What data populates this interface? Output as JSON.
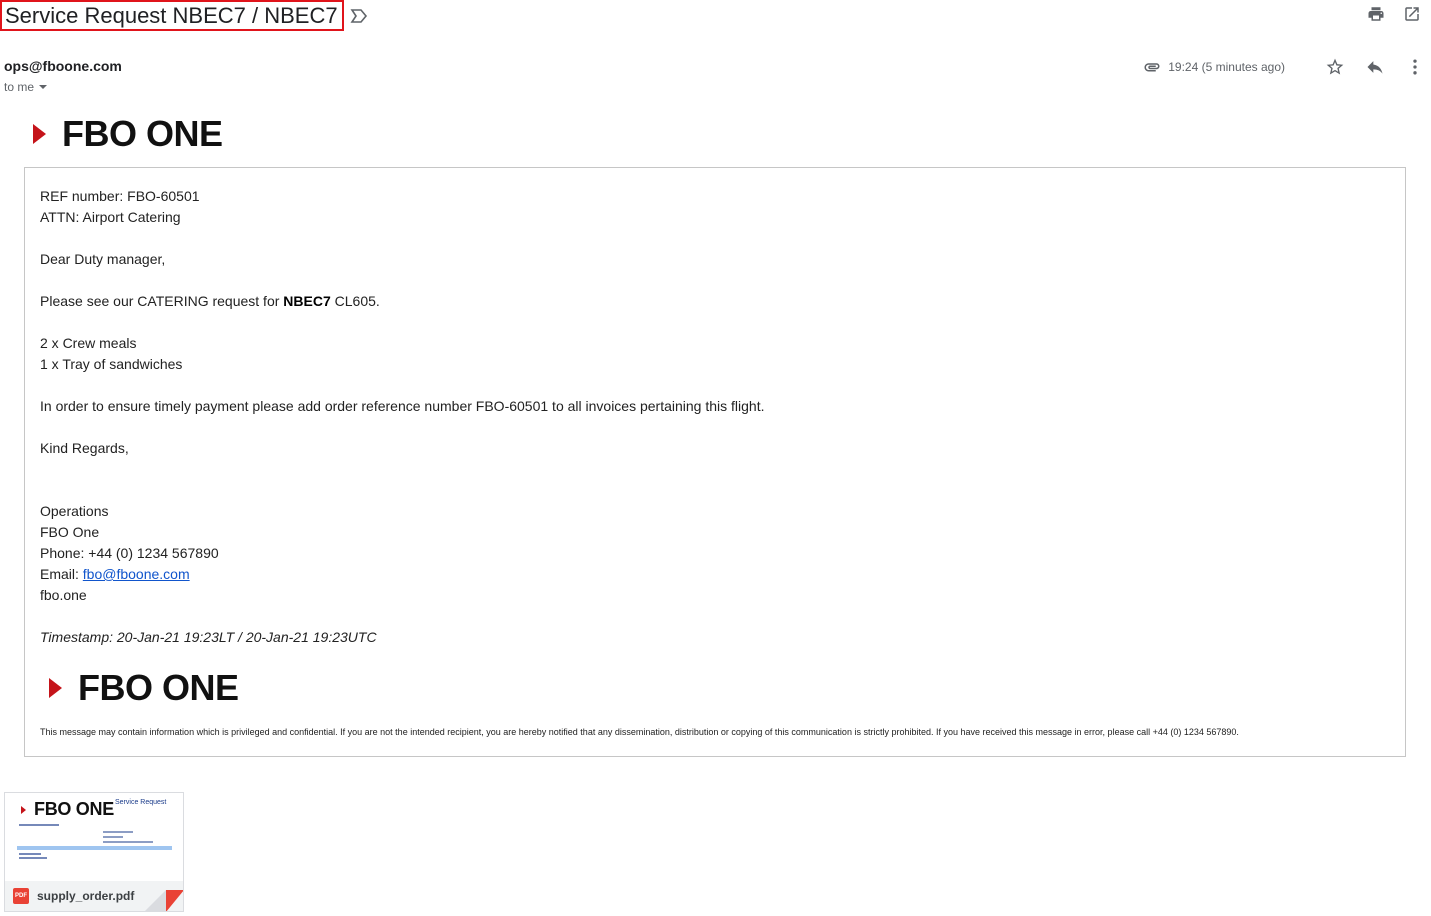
{
  "email": {
    "subject": "Service Request NBEC7 / NBEC7",
    "sender": "ops@fboone.com",
    "recipient": "to me",
    "time": "19:24 (5 minutes ago)"
  },
  "logo": {
    "text": "FBO ONE",
    "accent": "#c5141a"
  },
  "body": {
    "ref": "REF number: FBO-60501",
    "attn": "ATTN: Airport Catering",
    "greeting": "Dear Duty manager,",
    "request_prefix": "Please see our CATERING request for ",
    "request_bold": "NBEC7",
    "request_suffix": " CL605.",
    "item1": "2 x Crew meals",
    "item2": "1 x Tray of sandwiches",
    "payment_note": "In order to ensure timely payment please add order reference number FBO-60501 to all invoices pertaining this flight.",
    "closing": "Kind Regards,",
    "sig_dept": "Operations",
    "sig_company": "FBO One",
    "sig_phone": "Phone: +44 (0) 1234 567890",
    "sig_email_label": "Email: ",
    "sig_email": "fbo@fboone.com",
    "sig_web": "fbo.one",
    "timestamp": "Timestamp: 20-Jan-21 19:23LT / 20-Jan-21 19:23UTC",
    "disclaimer": "This message may contain information which is privileged and confidential. If you are not the intended recipient, you are hereby notified that any dissemination, distribution or copying of this communication is strictly prohibited. If you have received this message in error, please call +44 (0) 1234 567890."
  },
  "attachment": {
    "filename": "supply_order.pdf",
    "type_badge": "PDF",
    "thumb_logo": "FBO ONE",
    "thumb_title": "Service Request"
  }
}
